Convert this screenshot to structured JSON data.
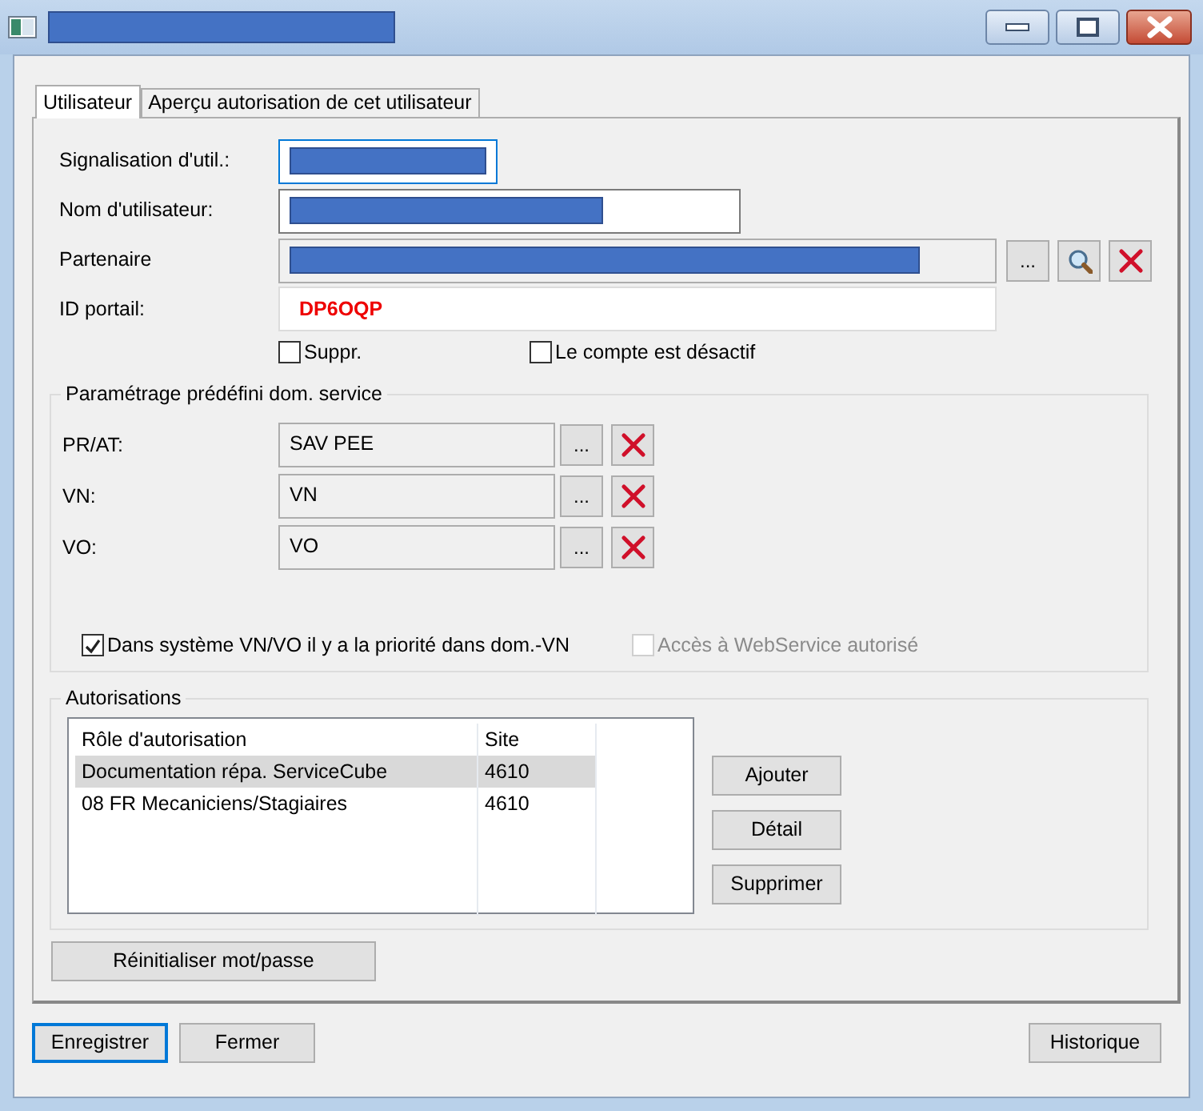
{
  "window": {
    "title_redacted": true
  },
  "tabs": [
    {
      "label": "Utilisateur",
      "selected": true
    },
    {
      "label": "Aperçu autorisation de cet utilisateur",
      "selected": false
    }
  ],
  "fields": [
    {
      "label": "Signalisation d'util.:",
      "redacted": true,
      "focused": true,
      "readonly": false
    },
    {
      "label": "Nom d'utilisateur:",
      "redacted": true,
      "focused": false,
      "readonly": false
    },
    {
      "label": "Partenaire",
      "redacted": true,
      "focused": false,
      "readonly": true,
      "buttons": [
        {
          "kind": "text",
          "label": "..."
        },
        {
          "kind": "search"
        },
        {
          "kind": "clear"
        }
      ]
    },
    {
      "label": "ID portail:",
      "value": "DP6OQP",
      "focused": false,
      "readonly": false
    }
  ],
  "checkboxes": [
    {
      "label": "Suppr.",
      "checked": false
    },
    {
      "label": "Le compte est désactif",
      "checked": false
    }
  ],
  "service_group": {
    "title": "Paramétrage prédéfini dom. service",
    "rows": [
      {
        "label": "PR/AT:",
        "value": "SAV PEE",
        "browse": "..."
      },
      {
        "label": "VN:",
        "value": "VN",
        "browse": "..."
      },
      {
        "label": "VO:",
        "value": "VO",
        "browse": "..."
      }
    ],
    "checkboxes": [
      {
        "label": "Dans système VN/VO il y a la priorité dans dom.-VN",
        "checked": true,
        "disabled": false
      },
      {
        "label": "Accès à WebService autorisé",
        "checked": false,
        "disabled": true
      }
    ]
  },
  "authorizations": {
    "title": "Autorisations",
    "columns": [
      "Rôle d'autorisation",
      "Site"
    ],
    "rows": [
      {
        "cells": [
          "Documentation répa. ServiceCube",
          "4610"
        ],
        "selected": true
      },
      {
        "cells": [
          "08 FR Mecaniciens/Stagiaires",
          "4610"
        ],
        "selected": false
      }
    ],
    "buttons": [
      "Ajouter",
      "Détail",
      "Supprimer"
    ]
  },
  "reset_button": "Réinitialiser mot/passe",
  "footer": {
    "buttons": [
      {
        "label": "Enregistrer",
        "default": true
      },
      {
        "label": "Fermer",
        "default": false
      }
    ],
    "history_button": "Historique"
  }
}
